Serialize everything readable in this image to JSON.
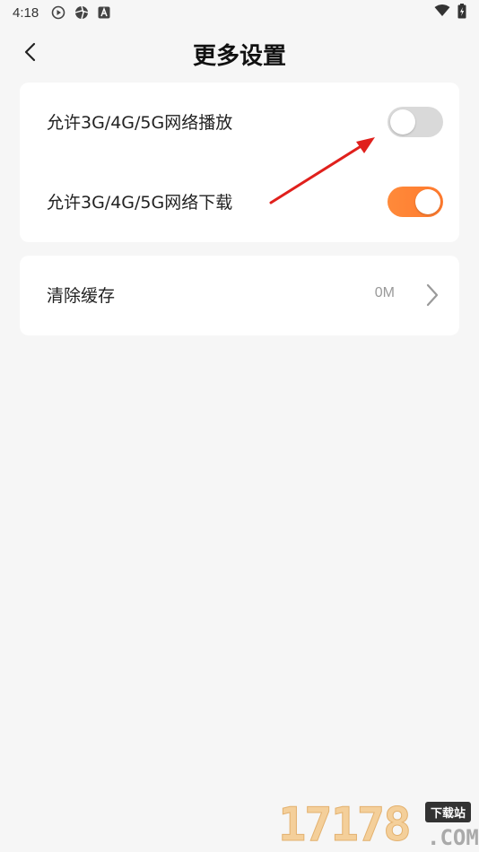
{
  "status_bar": {
    "time": "4:18",
    "icons": [
      "play-circle-icon",
      "aperture-icon",
      "a-box-icon"
    ],
    "right_icons": [
      "wifi-icon",
      "battery-charging-icon"
    ]
  },
  "header": {
    "title": "更多设置",
    "back_icon": "chevron-left-icon"
  },
  "settings": {
    "play_label": "允许3G/4G/5G网络播放",
    "play_enabled": false,
    "download_label": "允许3G/4G/5G网络下载",
    "download_enabled": true
  },
  "cache": {
    "label": "清除缓存",
    "value": "0M",
    "chevron_icon": "chevron-right-icon"
  },
  "watermark": {
    "digits": "17178",
    "badge": "下载站",
    "domain": ".COM"
  },
  "colors": {
    "accent": "#ff8236",
    "switch_off": "#d9d9d9",
    "arrow": "#e0201c",
    "background": "#f6f6f6"
  }
}
